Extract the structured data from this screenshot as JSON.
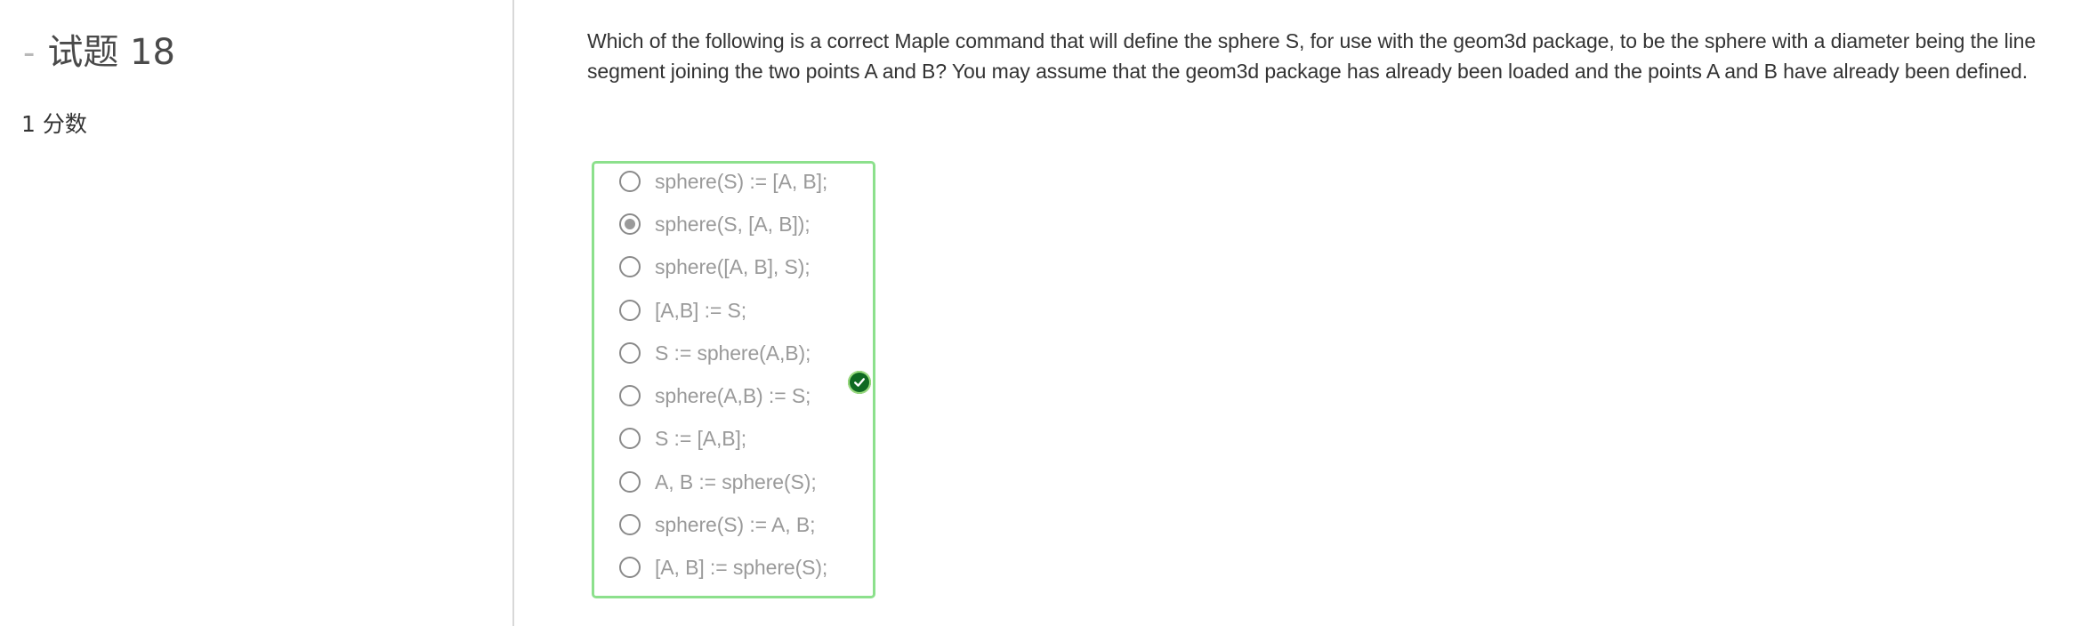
{
  "question": {
    "dash": "-",
    "title": "试题 18",
    "score": "1 分数"
  },
  "prompt": {
    "text": "Which of the following is a correct Maple command that will define the sphere S, for use with the geom3d package, to be the sphere with a diameter being the line segment joining the two points A and B?  You may assume that the geom3d package has already been loaded and the points A and B have already been defined."
  },
  "answers": {
    "selected_index": 1,
    "options": [
      {
        "label": "sphere(S) := [A, B];"
      },
      {
        "label": "sphere(S, [A, B]);"
      },
      {
        "label": "sphere([A, B], S);"
      },
      {
        "label": "[A,B] := S;"
      },
      {
        "label": "S := sphere(A,B);"
      },
      {
        "label": "sphere(A,B) := S;"
      },
      {
        "label": "S := [A,B];"
      },
      {
        "label": "A, B := sphere(S);"
      },
      {
        "label": "sphere(S) := A, B;"
      },
      {
        "label": "[A, B] := sphere(S);"
      }
    ],
    "status_icon": "correct-check-icon",
    "colors": {
      "border": "#8ce08c",
      "check_bg": "#0f6a22",
      "text": "#9a9a9a"
    }
  }
}
